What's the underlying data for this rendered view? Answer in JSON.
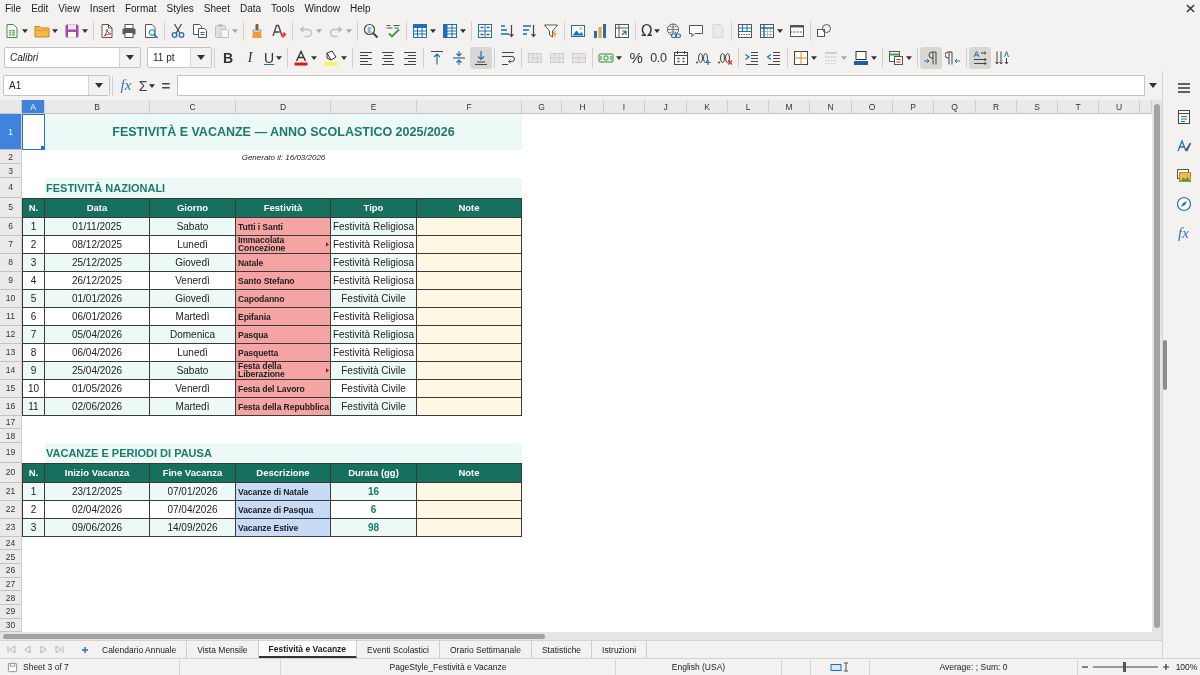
{
  "menu_bar": [
    "File",
    "Edit",
    "View",
    "Insert",
    "Format",
    "Styles",
    "Sheet",
    "Data",
    "Tools",
    "Window",
    "Help"
  ],
  "standard_toolbar": [
    {
      "dropdown": true,
      "disabled": false
    },
    {
      "dropdown": true,
      "disabled": false
    },
    {
      "dropdown": true,
      "disabled": false
    },
    {
      "dropdown": false,
      "disabled": false
    },
    {
      "dropdown": false,
      "disabled": false
    },
    {
      "dropdown": false,
      "disabled": false
    },
    {
      "dropdown": false,
      "disabled": false
    },
    {
      "dropdown": false,
      "disabled": false
    },
    {
      "dropdown": true,
      "disabled": true
    },
    {
      "dropdown": false,
      "disabled": false
    },
    {
      "dropdown": false,
      "disabled": false
    },
    {
      "dropdown": true,
      "disabled": true
    },
    {
      "dropdown": true,
      "disabled": true
    },
    {
      "dropdown": false,
      "disabled": false
    },
    {
      "dropdown": false,
      "disabled": false
    },
    {
      "dropdown": true,
      "disabled": false
    },
    {
      "dropdown": true,
      "disabled": false
    },
    {
      "dropdown": false,
      "disabled": false
    },
    {
      "dropdown": false,
      "disabled": false
    },
    {
      "dropdown": false,
      "disabled": false
    },
    {
      "dropdown": false,
      "disabled": false
    },
    {
      "dropdown": false,
      "disabled": false
    },
    {
      "dropdown": false,
      "disabled": false
    },
    {
      "dropdown": false,
      "disabled": false
    },
    {
      "dropdown": true,
      "disabled": false,
      "glyph": "Ω"
    },
    {
      "dropdown": false,
      "disabled": false
    },
    {
      "dropdown": false,
      "disabled": false
    },
    {
      "dropdown": false,
      "disabled": true
    },
    {
      "dropdown": false,
      "disabled": false
    },
    {
      "dropdown": true,
      "disabled": false
    },
    {
      "dropdown": false,
      "disabled": false
    },
    {
      "dropdown": false,
      "disabled": false
    }
  ],
  "formatting_toolbar": {
    "font_name": "Calibri",
    "font_size": "11 pt",
    "buttons": [
      {
        "glyph": "B",
        "dropdown": false,
        "disabled": false,
        "pressed": false
      },
      {
        "glyph": "I",
        "dropdown": false,
        "disabled": false,
        "pressed": false
      },
      {
        "glyph": "U",
        "dropdown": true,
        "disabled": false,
        "pressed": false
      },
      {
        "dropdown": true,
        "disabled": false,
        "pressed": false
      },
      {
        "dropdown": true,
        "disabled": false,
        "pressed": false
      },
      {
        "dropdown": false,
        "disabled": false,
        "pressed": false
      },
      {
        "dropdown": false,
        "disabled": false,
        "pressed": false
      },
      {
        "dropdown": false,
        "disabled": false,
        "pressed": false
      },
      {
        "dropdown": false,
        "disabled": false,
        "pressed": false
      },
      {
        "dropdown": false,
        "disabled": false,
        "pressed": false
      },
      {
        "dropdown": false,
        "disabled": false,
        "pressed": true
      },
      {
        "dropdown": false,
        "disabled": false,
        "pressed": false
      },
      {
        "dropdown": false,
        "disabled": true,
        "pressed": false
      },
      {
        "dropdown": false,
        "disabled": true,
        "pressed": false
      },
      {
        "dropdown": false,
        "disabled": true,
        "pressed": false
      },
      {
        "dropdown": true,
        "disabled": false,
        "pressed": false
      },
      {
        "glyph": "%",
        "dropdown": false,
        "disabled": false,
        "pressed": false
      },
      {
        "glyph": "0.0",
        "dropdown": false,
        "disabled": false,
        "pressed": false
      },
      {
        "dropdown": false,
        "disabled": false,
        "pressed": false
      },
      {
        "dropdown": false,
        "disabled": false,
        "pressed": false
      },
      {
        "dropdown": false,
        "disabled": false,
        "pressed": false
      },
      {
        "dropdown": false,
        "disabled": false,
        "pressed": false
      },
      {
        "dropdown": false,
        "disabled": false,
        "pressed": false
      },
      {
        "dropdown": true,
        "disabled": false,
        "pressed": false
      },
      {
        "dropdown": true,
        "disabled": true,
        "pressed": false
      },
      {
        "dropdown": true,
        "disabled": false,
        "pressed": false
      },
      {
        "dropdown": true,
        "disabled": false,
        "pressed": false
      },
      {
        "dropdown": false,
        "disabled": false,
        "pressed": true
      },
      {
        "dropdown": false,
        "disabled": false,
        "pressed": false
      },
      {
        "dropdown": false,
        "disabled": false,
        "pressed": true
      },
      {
        "dropdown": false,
        "disabled": false,
        "pressed": false
      }
    ]
  },
  "formula_bar": {
    "name_box": "A1",
    "function_wizard": "fx",
    "sum": "Σ",
    "equals": "="
  },
  "sidebar": {
    "functions_tab": "fx"
  },
  "sheet": {
    "column_headers": [
      {
        "label": "A",
        "selected": true
      },
      {
        "label": "B",
        "selected": false
      },
      {
        "label": "C",
        "selected": false
      },
      {
        "label": "D",
        "selected": false
      },
      {
        "label": "E",
        "selected": false
      },
      {
        "label": "F",
        "selected": false
      },
      {
        "label": "G",
        "selected": false
      },
      {
        "label": "H",
        "selected": false
      },
      {
        "label": "I",
        "selected": false
      },
      {
        "label": "J",
        "selected": false
      },
      {
        "label": "K",
        "selected": false
      },
      {
        "label": "L",
        "selected": false
      },
      {
        "label": "M",
        "selected": false
      },
      {
        "label": "N",
        "selected": false
      },
      {
        "label": "O",
        "selected": false
      },
      {
        "label": "P",
        "selected": false
      },
      {
        "label": "Q",
        "selected": false
      },
      {
        "label": "R",
        "selected": false
      },
      {
        "label": "S",
        "selected": false
      },
      {
        "label": "T",
        "selected": false
      },
      {
        "label": "U",
        "selected": false
      }
    ],
    "row_headers": [
      {
        "label": "1",
        "selected": true
      },
      {
        "label": "2",
        "selected": false
      },
      {
        "label": "3",
        "selected": false
      },
      {
        "label": "4",
        "selected": false
      },
      {
        "label": "5",
        "selected": false
      },
      {
        "label": "6",
        "selected": false
      },
      {
        "label": "7",
        "selected": false
      },
      {
        "label": "8",
        "selected": false
      },
      {
        "label": "9",
        "selected": false
      },
      {
        "label": "10",
        "selected": false
      },
      {
        "label": "11",
        "selected": false
      },
      {
        "label": "12",
        "selected": false
      },
      {
        "label": "13",
        "selected": false
      },
      {
        "label": "14",
        "selected": false
      },
      {
        "label": "15",
        "selected": false
      },
      {
        "label": "16",
        "selected": false
      },
      {
        "label": "17",
        "selected": false
      },
      {
        "label": "18",
        "selected": false
      },
      {
        "label": "19",
        "selected": false
      },
      {
        "label": "20",
        "selected": false
      },
      {
        "label": "21",
        "selected": false
      },
      {
        "label": "22",
        "selected": false
      },
      {
        "label": "23",
        "selected": false
      },
      {
        "label": "24",
        "selected": false
      },
      {
        "label": "25",
        "selected": false
      },
      {
        "label": "26",
        "selected": false
      },
      {
        "label": "27",
        "selected": false
      },
      {
        "label": "28",
        "selected": false
      },
      {
        "label": "29",
        "selected": false
      },
      {
        "label": "30",
        "selected": false
      }
    ],
    "title": "FESTIVITÀ E VACANZE — ANNO SCOLASTICO 2025/2026",
    "subtitle": "Generato il: 16/03/2026",
    "tables": [
      {
        "kind": "holidays",
        "heading": "FESTIVITÀ NAZIONALI",
        "columns": [
          {
            "label": "N.",
            "kind": "index"
          },
          {
            "label": "Data",
            "kind": "date"
          },
          {
            "label": "Giorno",
            "kind": "text"
          },
          {
            "label": "Festività",
            "kind": "name"
          },
          {
            "label": "Tipo",
            "kind": "text"
          },
          {
            "label": "Note",
            "kind": "note"
          }
        ],
        "rows": [
          {
            "cells": [
              "1",
              "01/11/2025",
              "Sabato",
              "Tutti i Santi",
              "Festività Religiosa"
            ],
            "overflow": false
          },
          {
            "cells": [
              "2",
              "08/12/2025",
              "Lunedì",
              "Immacolata Concezione",
              "Festività Religiosa"
            ],
            "overflow": true
          },
          {
            "cells": [
              "3",
              "25/12/2025",
              "Giovedì",
              "Natale",
              "Festività Religiosa"
            ],
            "overflow": false
          },
          {
            "cells": [
              "4",
              "26/12/2025",
              "Venerdì",
              "Santo Stefano",
              "Festività Religiosa"
            ],
            "overflow": false
          },
          {
            "cells": [
              "5",
              "01/01/2026",
              "Giovedì",
              "Capodanno",
              "Festività Civile"
            ],
            "overflow": false
          },
          {
            "cells": [
              "6",
              "06/01/2026",
              "Martedì",
              "Epifania",
              "Festività Religiosa"
            ],
            "overflow": false
          },
          {
            "cells": [
              "7",
              "05/04/2026",
              "Domenica",
              "Pasqua",
              "Festività Religiosa"
            ],
            "overflow": false
          },
          {
            "cells": [
              "8",
              "06/04/2026",
              "Lunedì",
              "Pasquetta",
              "Festività Religiosa"
            ],
            "overflow": false
          },
          {
            "cells": [
              "9",
              "25/04/2026",
              "Sabato",
              "Festa della Liberazione",
              "Festività Civile"
            ],
            "overflow": true
          },
          {
            "cells": [
              "10",
              "01/05/2026",
              "Venerdì",
              "Festa del Lavoro",
              "Festività Civile"
            ],
            "overflow": false
          },
          {
            "cells": [
              "11",
              "02/06/2026",
              "Martedì",
              "Festa della Repubblica",
              "Festività Civile"
            ],
            "overflow": false
          }
        ]
      },
      {
        "kind": "breaks",
        "heading": "VACANZE E PERIODI DI PAUSA",
        "columns": [
          {
            "label": "N.",
            "kind": "index"
          },
          {
            "label": "Inizio Vacanza",
            "kind": "date"
          },
          {
            "label": "Fine Vacanza",
            "kind": "date"
          },
          {
            "label": "Descrizione",
            "kind": "name"
          },
          {
            "label": "Durata (gg)",
            "kind": "amount"
          },
          {
            "label": "Note",
            "kind": "note"
          }
        ],
        "rows": [
          {
            "cells": [
              "1",
              "23/12/2025",
              "07/01/2026",
              "Vacanze di Natale",
              "16"
            ],
            "overflow": false
          },
          {
            "cells": [
              "2",
              "02/04/2026",
              "07/04/2026",
              "Vacanze di Pasqua",
              "6"
            ],
            "overflow": false
          },
          {
            "cells": [
              "3",
              "09/06/2026",
              "14/09/2026",
              "Vacanze Estive",
              "98"
            ],
            "overflow": false
          }
        ]
      }
    ]
  },
  "sheet_tabs": [
    {
      "label": "Calendario Annuale",
      "selected": false
    },
    {
      "label": "Vista Mensile",
      "selected": false
    },
    {
      "label": "Festività e Vacanze",
      "selected": true
    },
    {
      "label": "Eventi Scolastici",
      "selected": false
    },
    {
      "label": "Orario Settimanale",
      "selected": false
    },
    {
      "label": "Statistiche",
      "selected": false
    },
    {
      "label": "Istruzioni",
      "selected": false
    }
  ],
  "status_bar": {
    "sheet_position": "Sheet 3 of 7",
    "page_style": "PageStyle_Festività e Vacanze",
    "language": "English (USA)",
    "selection_summary": "Average: ; Sum: 0",
    "zoom": {
      "level": 0.48,
      "value": "100%"
    }
  }
}
